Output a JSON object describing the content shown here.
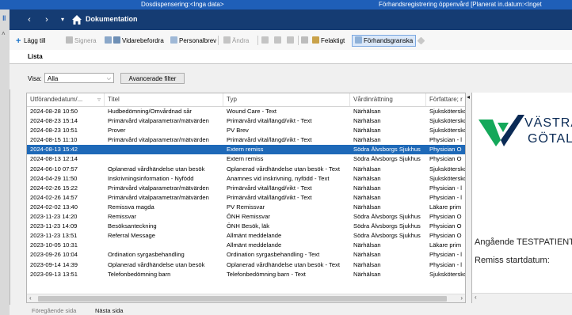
{
  "status_bar": {
    "left": "Dosdispensering:<Inga data>",
    "right": "Förhandsregistrering öppenvård [Planerat in.datum:<Inget"
  },
  "nav": {
    "back_icon": "arrow-left-icon",
    "forward_icon": "arrow-right-icon",
    "dropdown_icon": "chevron-down-icon",
    "home_icon": "home-icon",
    "title": "Dokumentation"
  },
  "toolbar": {
    "add": "Lägg till",
    "sign": "Signera",
    "forward": "Vidarebefordra",
    "personal_letter": "Personalbrev",
    "change": "Ändra",
    "wrong": "Felaktigt",
    "preview": "Förhandsgranska"
  },
  "tabs": {
    "list": "Lista"
  },
  "filter": {
    "label": "Visa:",
    "value": "Alla",
    "advanced_button": "Avancerade filter"
  },
  "table": {
    "headers": [
      "Utförandedatum/...",
      "Titel",
      "Typ",
      "Vårdinrättning",
      "Författare; r"
    ],
    "rows": [
      [
        "2024-08-28 10:50",
        "Hudbedömning/Omvårdnad sår",
        "Wound Care - Text",
        "Närhälsan",
        "Sjuksköterskо"
      ],
      [
        "2024-08-23 15:14",
        "Primärvård vitalparametrar/mätvärden",
        "Primärvård vital/längd/vikt - Text",
        "Närhälsan",
        "Sjuksköterskо"
      ],
      [
        "2024-08-23 10:51",
        "Prover",
        "PV Brev",
        "Närhälsan",
        "Sjuksköterskо"
      ],
      [
        "2024-08-15 11:10",
        "Primärvård vitalparametrar/mätvärden",
        "Primärvård vital/längd/vikt - Text",
        "Närhälsan",
        "Physician - l"
      ],
      [
        "2024-08-13 15:42",
        "",
        "Extern remiss",
        "Södra Älvsborgs Sjukhus",
        "Physician O"
      ],
      [
        "2024-08-13 12:14",
        "",
        "Extern remiss",
        "Södra Älvsborgs Sjukhus",
        "Physician O"
      ],
      [
        "2024-06-10 07:57",
        "Oplanerad vårdhändelse utan besök",
        "Oplanerad vårdhändelse utan besök - Text",
        "Närhälsan",
        "Sjuksköterskо"
      ],
      [
        "2024-04-29 11:50",
        "Inskrivningsinformation - Nyfödd",
        "Anamnes vid inskrivning, nyfödd - Text",
        "Närhälsan",
        "Sjuksköterskо"
      ],
      [
        "2024-02-26 15:22",
        "Primärvård vitalparametrar/mätvärden",
        "Primärvård vital/längd/vikt - Text",
        "Närhälsan",
        "Physician - l"
      ],
      [
        "2024-02-26 14:57",
        "Primärvård vitalparametrar/mätvärden",
        "Primärvård vital/längd/vikt - Text",
        "Närhälsan",
        "Physician - l"
      ],
      [
        "2024-02-02 13:40",
        "Remissva magda",
        "PV Remissvar",
        "Närhälsan",
        "Läkare prim"
      ],
      [
        "2023-11-23 14:20",
        "Remissvar",
        "ÖNH Remissvar",
        "Södra Älvsborgs Sjukhus",
        "Physician O"
      ],
      [
        "2023-11-23 14:09",
        "Besöksanteckning",
        "ÖNH Besök, läk",
        "Södra Älvsborgs Sjukhus",
        "Physician O"
      ],
      [
        "2023-11-23 13:51",
        "Referral Message",
        "Allmänt meddelande",
        "Södra Älvsborgs Sjukhus",
        "Physician O"
      ],
      [
        "2023-10-05 10:31",
        "",
        "Allmänt meddelande",
        "Närhälsan",
        "Läkare prim"
      ],
      [
        "2023-09-26 10:04",
        "Ordination syrgasbehandling",
        "Ordination syrgasbehandling - Text",
        "Närhälsan",
        "Physician - l"
      ],
      [
        "2023-09-14 14:39",
        "Oplanerad vårdhändelse utan besök",
        "Oplanerad vårdhändelse utan besök - Text",
        "Närhälsan",
        "Physician - l"
      ],
      [
        "2023-09-13 13:51",
        "Telefonbedömning barn",
        "Telefonbedömning barn - Text",
        "Närhälsan",
        "Sjuksköterskо"
      ]
    ],
    "selected_row": 4
  },
  "preview": {
    "logo_line1": "VÄSTRA",
    "logo_line2": "GÖTALA",
    "line1": "Angående TESTPATIENT",
    "line2": "Remiss startdatum:"
  },
  "pager": {
    "prev": "Föregående sida",
    "next": "Nästa sida"
  },
  "colors": {
    "status_bar": "#1f5fb8",
    "nav_bar": "#153c73",
    "selection": "#1e69b8",
    "logo_green": "#14a85a",
    "logo_navy": "#0a2a55"
  }
}
